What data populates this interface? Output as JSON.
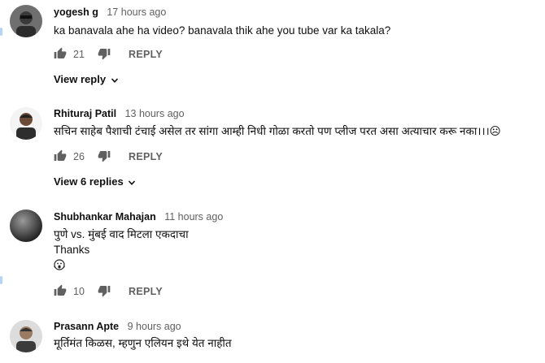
{
  "comments": [
    {
      "author": "yogesh g",
      "time": "17 hours ago",
      "lines": [
        "ka banavala ahe ha video?  banavala thik ahe you tube var ka takala?"
      ],
      "likes": "21",
      "reply_label": "REPLY",
      "view_replies": "View reply",
      "avatar_icon": "user-avatar-photo"
    },
    {
      "author": "Rhituraj Patil",
      "time": "13 hours ago",
      "lines": [
        "सचिन साहेब पैशाची टंचाई असेल तर सांगा आम्ही निधी गोळा करतो पण प्लीज परत असा अत्याचार करू नका।।।☹"
      ],
      "likes": "26",
      "reply_label": "REPLY",
      "view_replies": "View 6 replies",
      "avatar_icon": "user-avatar-photo"
    },
    {
      "author": "Shubhankar Mahajan",
      "time": "11 hours ago",
      "lines": [
        "पुणे vs. मुंबई वाद मिटला एकदाचा",
        "Thanks"
      ],
      "likes": "10",
      "reply_label": "REPLY",
      "avatar_icon": "user-avatar-photo"
    },
    {
      "author": "Prasann Apte",
      "time": "9 hours ago",
      "lines": [
        "मूर्तिमंत किळस,  म्हणुन एलियन इथे येत नाहीत"
      ],
      "avatar_icon": "user-avatar-photo"
    }
  ],
  "icons": {
    "like": "thumbs-up-icon",
    "dislike": "thumbs-down-icon",
    "expand": "chevron-down-icon",
    "emoji": "screaming-face-emoji"
  },
  "colors": {
    "text": "#0f0f0f",
    "meta": "#606060",
    "background": "#ffffff"
  }
}
